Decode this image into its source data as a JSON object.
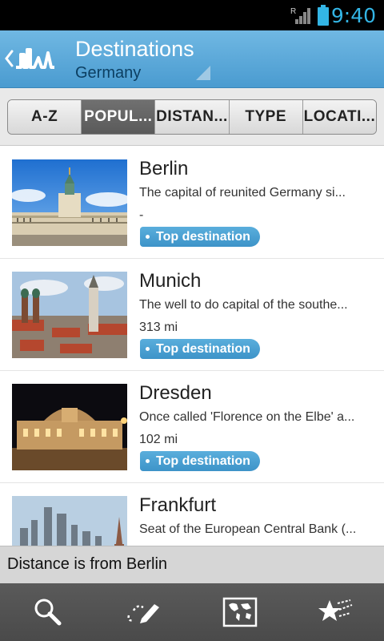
{
  "status_bar": {
    "time": "9:40",
    "network_label": "R",
    "accent_color": "#33b5e5"
  },
  "header": {
    "title": "Destinations",
    "subtitle": "Germany",
    "back_icon": "chevron-left-icon",
    "logo_icon": "city-skyline-logo-icon"
  },
  "tabs": [
    {
      "label": "A-Z",
      "active": false
    },
    {
      "label": "POPUL...",
      "active": true
    },
    {
      "label": "DISTAN...",
      "active": false
    },
    {
      "label": "TYPE",
      "active": false
    },
    {
      "label": "LOCATI...",
      "active": false
    }
  ],
  "destinations": [
    {
      "name": "Berlin",
      "description": "The capital of reunited Germany si...",
      "distance": "-",
      "badge": "Top destination"
    },
    {
      "name": "Munich",
      "description": "The well to do capital of the southe...",
      "distance": "313 mi",
      "badge": "Top destination"
    },
    {
      "name": "Dresden",
      "description": "Once called 'Florence on the Elbe' a...",
      "distance": "102 mi",
      "badge": "Top destination"
    },
    {
      "name": "Frankfurt",
      "description": "Seat of the European Central Bank (...",
      "distance": "",
      "badge": ""
    }
  ],
  "footer_note": "Distance is from Berlin",
  "bottom_nav": [
    {
      "icon": "search-icon"
    },
    {
      "icon": "edit-notes-icon"
    },
    {
      "icon": "world-map-icon"
    },
    {
      "icon": "favorites-stars-icon"
    }
  ],
  "colors": {
    "header": "#5aa8d9",
    "badge": "#4a9fd2",
    "bottom_nav": "#525252"
  }
}
